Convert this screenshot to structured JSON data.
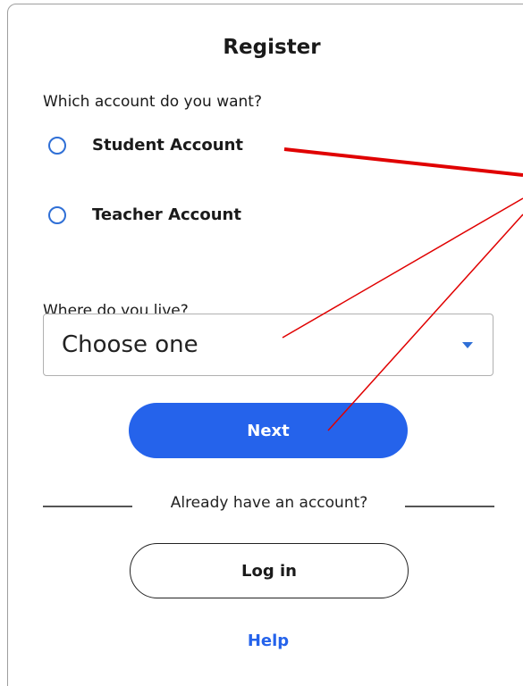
{
  "register": {
    "title": "Register",
    "account_question": "Which account do you want?",
    "account_options": [
      {
        "label": "Student Account"
      },
      {
        "label": "Teacher Account"
      }
    ],
    "location_question": "Where do you live?",
    "location_select": {
      "selected": "Choose one"
    },
    "next_label": "Next",
    "divider_text": "Already have an account?",
    "login_label": "Log in",
    "help_label": "Help"
  },
  "colors": {
    "accent": "#2563eb",
    "annotation": "#e00000"
  },
  "icons": {
    "radio": "radio-unchecked-icon",
    "dropdown": "chevron-down-icon"
  }
}
